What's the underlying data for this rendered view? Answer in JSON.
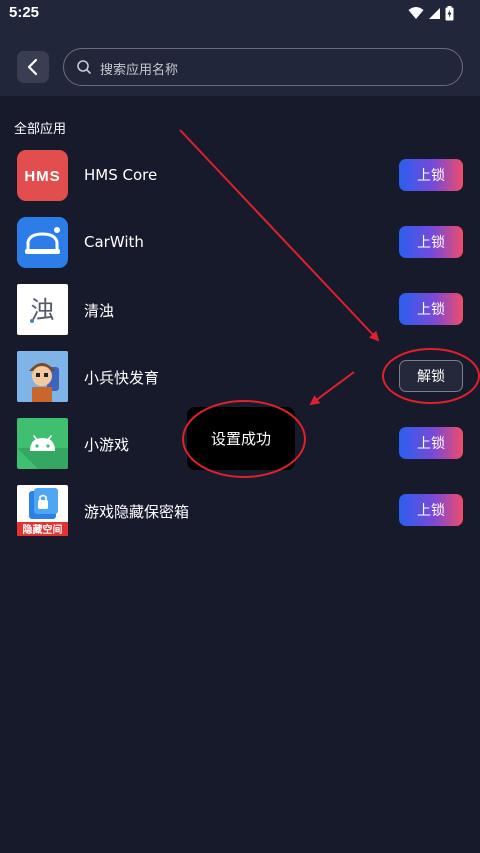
{
  "status_bar": {
    "time": "5:25",
    "icons": [
      "wifi-icon",
      "signal-icon",
      "battery-charging-icon"
    ]
  },
  "header": {
    "back_icon": "chevron-left-icon",
    "search": {
      "placeholder": "搜索应用名称",
      "icon": "search-icon"
    }
  },
  "section_title": "全部应用",
  "apps": [
    {
      "name": "HMS Core",
      "action": "上锁",
      "locked": false,
      "icon": "hms-core-app-icon",
      "icon_text": "HMS",
      "icon_color": "#e24d4d"
    },
    {
      "name": "CarWith",
      "action": "上锁",
      "locked": false,
      "icon": "carwith-app-icon",
      "icon_color": "#2c7de8"
    },
    {
      "name": "清浊",
      "action": "上锁",
      "locked": false,
      "icon": "qingzhuo-app-icon",
      "icon_text": "浊",
      "icon_color": "#ffffff"
    },
    {
      "name": "小兵快发育",
      "action": "解锁",
      "locked": true,
      "icon": "soldier-game-app-icon",
      "icon_color": "#7fb4e8"
    },
    {
      "name": "小游戏",
      "action": "上锁",
      "locked": false,
      "icon": "android-app-icon",
      "icon_color": "#3fbf6f"
    },
    {
      "name": "游戏隐藏保密箱",
      "action": "上锁",
      "locked": false,
      "icon": "hidden-space-app-icon",
      "icon_text": "隐藏空间",
      "icon_color": "#ffffff"
    }
  ],
  "toast": {
    "text": "设置成功"
  },
  "colors": {
    "background": "#171a2b",
    "header": "#22263a",
    "lock_gradient": [
      "#2a5ff0",
      "#7b49d6",
      "#ef4c6a"
    ],
    "annotation": "#e0202a"
  }
}
